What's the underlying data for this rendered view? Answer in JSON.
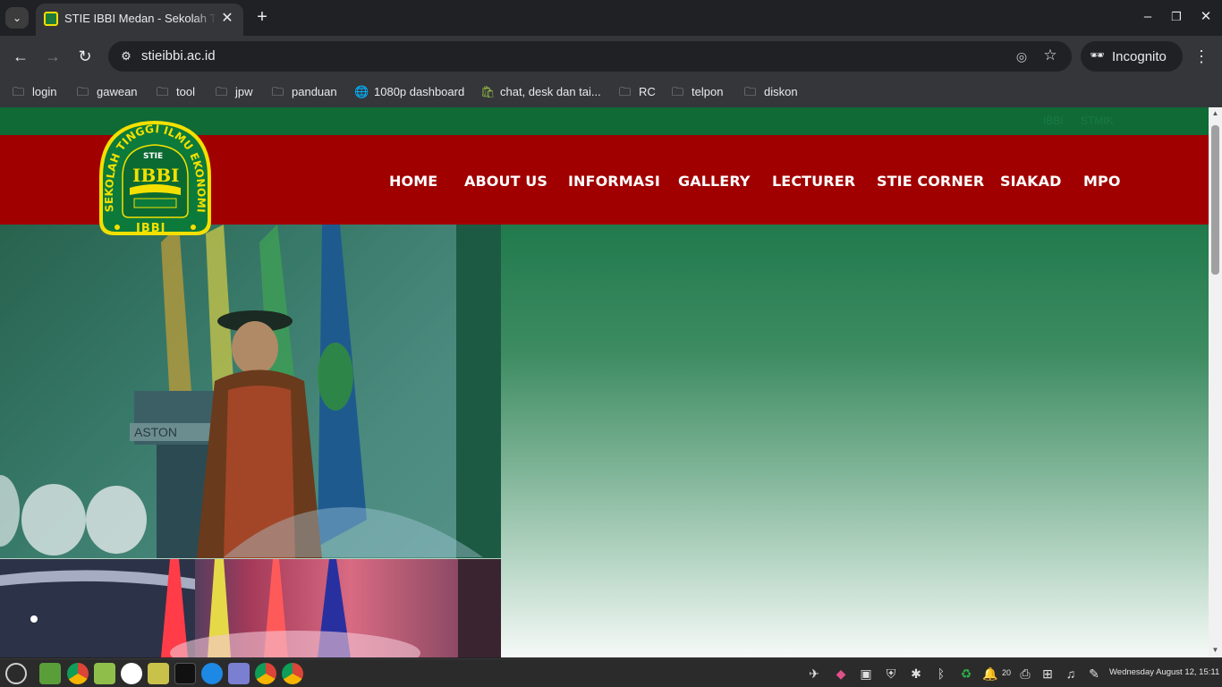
{
  "browser": {
    "tab_title": "STIE IBBI Medan - Sekolah Tinggi",
    "url": "stieibbi.ac.id",
    "incognito_label": "Incognito",
    "bookmarks": [
      {
        "label": "login",
        "icon": "folder-icon"
      },
      {
        "label": "gawean",
        "icon": "folder-icon"
      },
      {
        "label": "tool",
        "icon": "folder-icon"
      },
      {
        "label": "jpw",
        "icon": "folder-icon"
      },
      {
        "label": "panduan",
        "icon": "folder-icon"
      },
      {
        "label": "1080p dashboard",
        "icon": "globe-icon"
      },
      {
        "label": "chat, desk dan tai...",
        "icon": "shopify-icon"
      },
      {
        "label": "RC",
        "icon": "folder-icon"
      },
      {
        "label": "telpon",
        "icon": "folder-icon"
      },
      {
        "label": "diskon",
        "icon": "folder-icon"
      }
    ]
  },
  "site": {
    "top_links": [
      "IBBI",
      "STMIK"
    ],
    "logo": {
      "arc_text": "SEKOLAH TINGGI ILMU EKONOMI",
      "center": "STIE",
      "bottom": "IBBI",
      "mark": "IBBI"
    },
    "nav": [
      "HOME",
      "ABOUT US",
      "INFORMASI",
      "GALLERY",
      "LECTURER",
      "STIE CORNER",
      "SIAKAD",
      "MPO"
    ],
    "podium_text": "ASTON",
    "colors": {
      "nav_red": "#a10000",
      "green": "#0f6a36",
      "logo_yellow": "#f4e000"
    }
  },
  "taskbar": {
    "clock": "Wednesday August 12, 15:11",
    "volume": "20"
  }
}
